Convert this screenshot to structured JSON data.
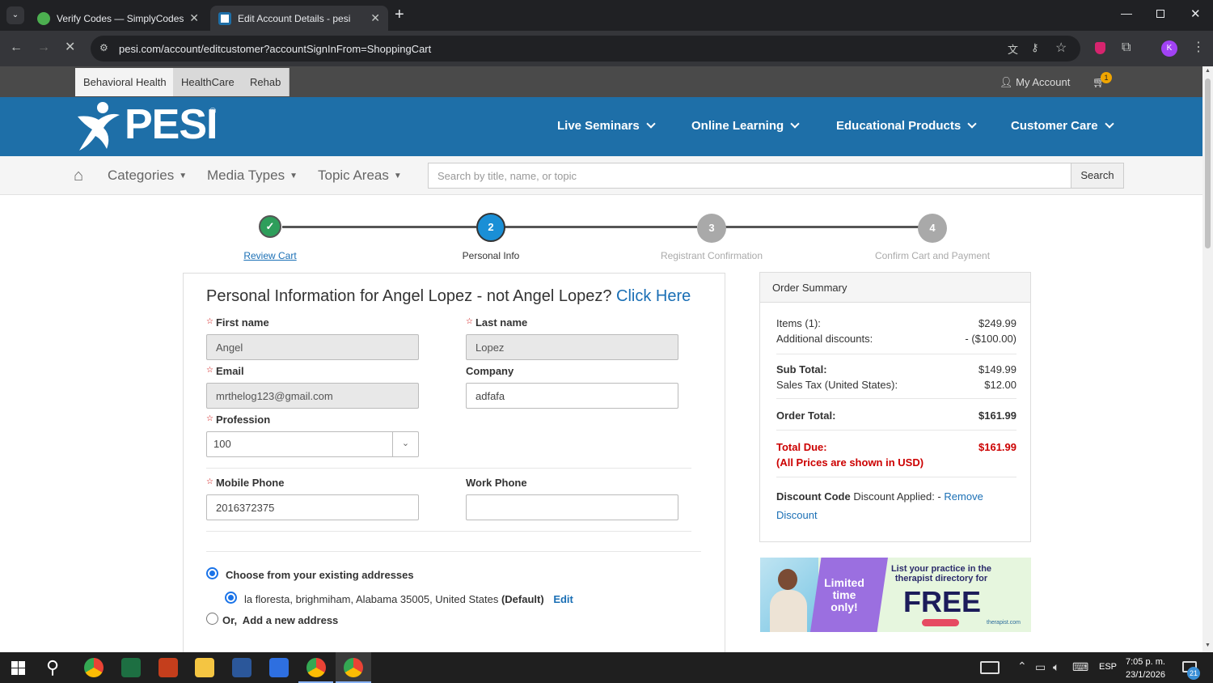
{
  "browser": {
    "tabs": [
      {
        "title": "Verify Codes — SimplyCodes",
        "active": false
      },
      {
        "title": "Edit Account Details - pesi",
        "active": true
      }
    ],
    "new_tab": "+",
    "url": "pesi.com/account/editcustomer?accountSignInFrom=ShoppingCart",
    "profile_initial": "K",
    "window_controls": [
      "minimize-icon",
      "restore-icon",
      "close-icon"
    ]
  },
  "site": {
    "top_tabs": [
      "Behavioral Health",
      "HealthCare",
      "Rehab"
    ],
    "my_account": "My Account",
    "cart_count": "1",
    "logo_text": "PESI",
    "logo_reg": "®",
    "main_nav": [
      "Live Seminars",
      "Online Learning",
      "Educational Products",
      "Customer Care"
    ],
    "sub_nav": [
      "Categories",
      "Media Types",
      "Topic Areas"
    ],
    "search": {
      "placeholder": "Search by title, name, or topic",
      "button": "Search"
    }
  },
  "steps": [
    {
      "num": "✓",
      "label": "Review Cart",
      "state": "done",
      "color": "#2e9e5b"
    },
    {
      "num": "2",
      "label": "Personal Info",
      "state": "current",
      "color": "#1a8fd6"
    },
    {
      "num": "3",
      "label": "Registrant Confirmation",
      "state": "todo",
      "color": "#a9a9a9"
    },
    {
      "num": "4",
      "label": "Confirm Cart and Payment",
      "state": "todo",
      "color": "#a9a9a9"
    }
  ],
  "form": {
    "heading": "Personal Information for Angel Lopez - not Angel Lopez?",
    "heading_link": "Click Here",
    "first_name": {
      "label": "First name",
      "value": "Angel"
    },
    "last_name": {
      "label": "Last name",
      "value": "Lopez"
    },
    "email": {
      "label": "Email",
      "value": "mrthelog123@gmail.com"
    },
    "company": {
      "label": "Company",
      "value": "adfafa"
    },
    "profession": {
      "label": "Profession",
      "value": "100"
    },
    "mobile_phone": {
      "label": "Mobile Phone",
      "value": "2016372375"
    },
    "work_phone": {
      "label": "Work Phone",
      "value": ""
    },
    "address_choice": "Choose from your existing addresses",
    "address": "la floresta, brighmiham, Alabama 35005, United States",
    "address_default": "(Default)",
    "address_edit": "Edit",
    "add_new": "Or,  Add a new address"
  },
  "summary": {
    "title": "Order Summary",
    "items_label": "Items (1):",
    "items_value": "$249.99",
    "discounts_label": "Additional discounts:",
    "discounts_value": "- ($100.00)",
    "subtotal_label": "Sub Total:",
    "subtotal_value": "$149.99",
    "tax_label": "Sales Tax (United States):",
    "tax_value": "$12.00",
    "order_total_label": "Order Total:",
    "order_total_value": "$161.99",
    "total_due_label": "Total Due:",
    "total_due_value": "$161.99",
    "usd_note": "(All Prices are shown in USD)",
    "discount_code_label": "Discount Code",
    "discount_applied": "Discount Applied: -",
    "remove_discount": "Remove Discount"
  },
  "ad": {
    "left_text": "Limited time only!",
    "headline": "List your practice in the therapist directory for",
    "big": "FREE",
    "brand": "therapist.com"
  },
  "taskbar": {
    "lang": "ESP",
    "time": "7:05 p. m.",
    "date": "23/1/2026",
    "notifications": "21"
  }
}
